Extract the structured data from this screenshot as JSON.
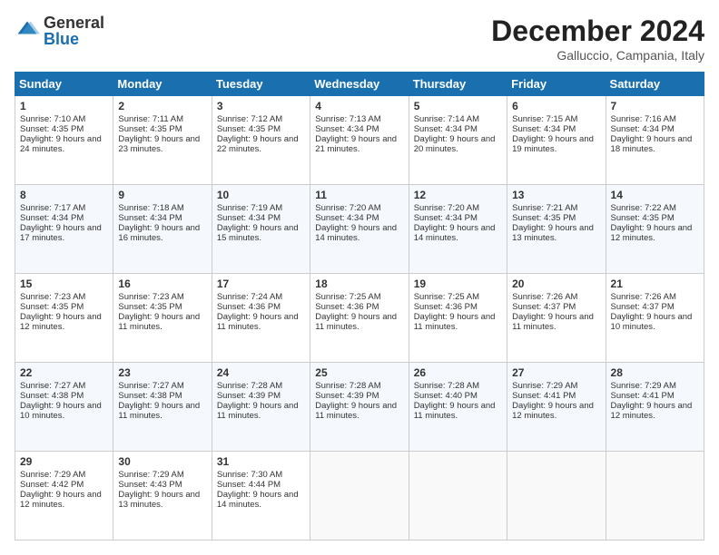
{
  "logo": {
    "general": "General",
    "blue": "Blue"
  },
  "header": {
    "month": "December 2024",
    "location": "Galluccio, Campania, Italy"
  },
  "days_of_week": [
    "Sunday",
    "Monday",
    "Tuesday",
    "Wednesday",
    "Thursday",
    "Friday",
    "Saturday"
  ],
  "weeks": [
    [
      {
        "day": "1",
        "sunrise": "Sunrise: 7:10 AM",
        "sunset": "Sunset: 4:35 PM",
        "daylight": "Daylight: 9 hours and 24 minutes."
      },
      {
        "day": "2",
        "sunrise": "Sunrise: 7:11 AM",
        "sunset": "Sunset: 4:35 PM",
        "daylight": "Daylight: 9 hours and 23 minutes."
      },
      {
        "day": "3",
        "sunrise": "Sunrise: 7:12 AM",
        "sunset": "Sunset: 4:35 PM",
        "daylight": "Daylight: 9 hours and 22 minutes."
      },
      {
        "day": "4",
        "sunrise": "Sunrise: 7:13 AM",
        "sunset": "Sunset: 4:34 PM",
        "daylight": "Daylight: 9 hours and 21 minutes."
      },
      {
        "day": "5",
        "sunrise": "Sunrise: 7:14 AM",
        "sunset": "Sunset: 4:34 PM",
        "daylight": "Daylight: 9 hours and 20 minutes."
      },
      {
        "day": "6",
        "sunrise": "Sunrise: 7:15 AM",
        "sunset": "Sunset: 4:34 PM",
        "daylight": "Daylight: 9 hours and 19 minutes."
      },
      {
        "day": "7",
        "sunrise": "Sunrise: 7:16 AM",
        "sunset": "Sunset: 4:34 PM",
        "daylight": "Daylight: 9 hours and 18 minutes."
      }
    ],
    [
      {
        "day": "8",
        "sunrise": "Sunrise: 7:17 AM",
        "sunset": "Sunset: 4:34 PM",
        "daylight": "Daylight: 9 hours and 17 minutes."
      },
      {
        "day": "9",
        "sunrise": "Sunrise: 7:18 AM",
        "sunset": "Sunset: 4:34 PM",
        "daylight": "Daylight: 9 hours and 16 minutes."
      },
      {
        "day": "10",
        "sunrise": "Sunrise: 7:19 AM",
        "sunset": "Sunset: 4:34 PM",
        "daylight": "Daylight: 9 hours and 15 minutes."
      },
      {
        "day": "11",
        "sunrise": "Sunrise: 7:20 AM",
        "sunset": "Sunset: 4:34 PM",
        "daylight": "Daylight: 9 hours and 14 minutes."
      },
      {
        "day": "12",
        "sunrise": "Sunrise: 7:20 AM",
        "sunset": "Sunset: 4:34 PM",
        "daylight": "Daylight: 9 hours and 14 minutes."
      },
      {
        "day": "13",
        "sunrise": "Sunrise: 7:21 AM",
        "sunset": "Sunset: 4:35 PM",
        "daylight": "Daylight: 9 hours and 13 minutes."
      },
      {
        "day": "14",
        "sunrise": "Sunrise: 7:22 AM",
        "sunset": "Sunset: 4:35 PM",
        "daylight": "Daylight: 9 hours and 12 minutes."
      }
    ],
    [
      {
        "day": "15",
        "sunrise": "Sunrise: 7:23 AM",
        "sunset": "Sunset: 4:35 PM",
        "daylight": "Daylight: 9 hours and 12 minutes."
      },
      {
        "day": "16",
        "sunrise": "Sunrise: 7:23 AM",
        "sunset": "Sunset: 4:35 PM",
        "daylight": "Daylight: 9 hours and 11 minutes."
      },
      {
        "day": "17",
        "sunrise": "Sunrise: 7:24 AM",
        "sunset": "Sunset: 4:36 PM",
        "daylight": "Daylight: 9 hours and 11 minutes."
      },
      {
        "day": "18",
        "sunrise": "Sunrise: 7:25 AM",
        "sunset": "Sunset: 4:36 PM",
        "daylight": "Daylight: 9 hours and 11 minutes."
      },
      {
        "day": "19",
        "sunrise": "Sunrise: 7:25 AM",
        "sunset": "Sunset: 4:36 PM",
        "daylight": "Daylight: 9 hours and 11 minutes."
      },
      {
        "day": "20",
        "sunrise": "Sunrise: 7:26 AM",
        "sunset": "Sunset: 4:37 PM",
        "daylight": "Daylight: 9 hours and 11 minutes."
      },
      {
        "day": "21",
        "sunrise": "Sunrise: 7:26 AM",
        "sunset": "Sunset: 4:37 PM",
        "daylight": "Daylight: 9 hours and 10 minutes."
      }
    ],
    [
      {
        "day": "22",
        "sunrise": "Sunrise: 7:27 AM",
        "sunset": "Sunset: 4:38 PM",
        "daylight": "Daylight: 9 hours and 10 minutes."
      },
      {
        "day": "23",
        "sunrise": "Sunrise: 7:27 AM",
        "sunset": "Sunset: 4:38 PM",
        "daylight": "Daylight: 9 hours and 11 minutes."
      },
      {
        "day": "24",
        "sunrise": "Sunrise: 7:28 AM",
        "sunset": "Sunset: 4:39 PM",
        "daylight": "Daylight: 9 hours and 11 minutes."
      },
      {
        "day": "25",
        "sunrise": "Sunrise: 7:28 AM",
        "sunset": "Sunset: 4:39 PM",
        "daylight": "Daylight: 9 hours and 11 minutes."
      },
      {
        "day": "26",
        "sunrise": "Sunrise: 7:28 AM",
        "sunset": "Sunset: 4:40 PM",
        "daylight": "Daylight: 9 hours and 11 minutes."
      },
      {
        "day": "27",
        "sunrise": "Sunrise: 7:29 AM",
        "sunset": "Sunset: 4:41 PM",
        "daylight": "Daylight: 9 hours and 12 minutes."
      },
      {
        "day": "28",
        "sunrise": "Sunrise: 7:29 AM",
        "sunset": "Sunset: 4:41 PM",
        "daylight": "Daylight: 9 hours and 12 minutes."
      }
    ],
    [
      {
        "day": "29",
        "sunrise": "Sunrise: 7:29 AM",
        "sunset": "Sunset: 4:42 PM",
        "daylight": "Daylight: 9 hours and 12 minutes."
      },
      {
        "day": "30",
        "sunrise": "Sunrise: 7:29 AM",
        "sunset": "Sunset: 4:43 PM",
        "daylight": "Daylight: 9 hours and 13 minutes."
      },
      {
        "day": "31",
        "sunrise": "Sunrise: 7:30 AM",
        "sunset": "Sunset: 4:44 PM",
        "daylight": "Daylight: 9 hours and 14 minutes."
      },
      null,
      null,
      null,
      null
    ]
  ]
}
